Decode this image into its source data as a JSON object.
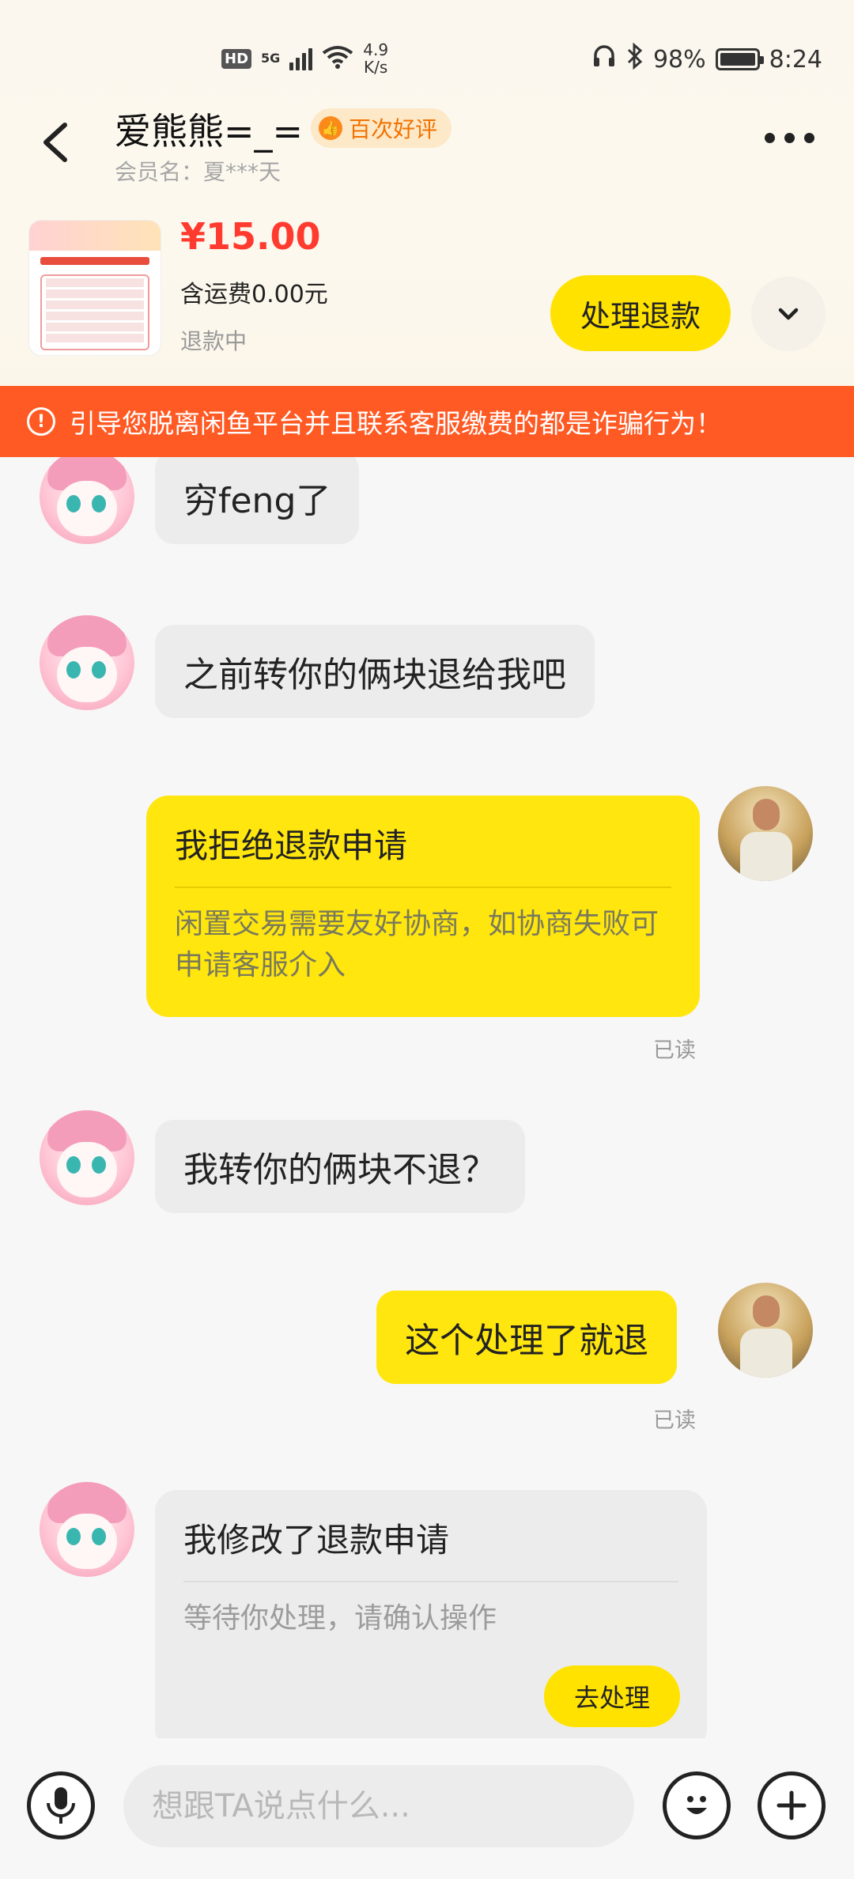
{
  "status_bar": {
    "hd": "HD",
    "net": "5G",
    "speed_value": "4.9",
    "speed_unit": "K/s",
    "battery": "98%",
    "time": "8:24"
  },
  "header": {
    "user_name": "爱熊熊=_=",
    "rating_badge": "百次好评",
    "member_name": "会员名：夏***天"
  },
  "product": {
    "price": "¥15.00",
    "shipping": "含运费0.00元",
    "status": "退款中",
    "action_label": "处理退款"
  },
  "warning": {
    "text": "引导您脱离闲鱼平台并且联系客服缴费的都是诈骗行为！"
  },
  "messages": {
    "m1": "穷feng了",
    "m2": "之前转你的俩块退给我吧",
    "card1": {
      "title": "我拒绝退款申请",
      "desc": "闲置交易需要友好协商，如协商失败可申请客服介入",
      "read": "已读"
    },
    "m3": "我转你的俩块不退？",
    "m4": "这个处理了就退",
    "m4_read": "已读",
    "card2": {
      "title": "我修改了退款申请",
      "desc": "等待你处理，请确认操作",
      "action": "去处理"
    }
  },
  "composer": {
    "placeholder": "想跟TA说点什么..."
  },
  "colors": {
    "accent_yellow": "#ffe60f",
    "warning_red": "#ff5a24",
    "price_red": "#ff3b30"
  }
}
